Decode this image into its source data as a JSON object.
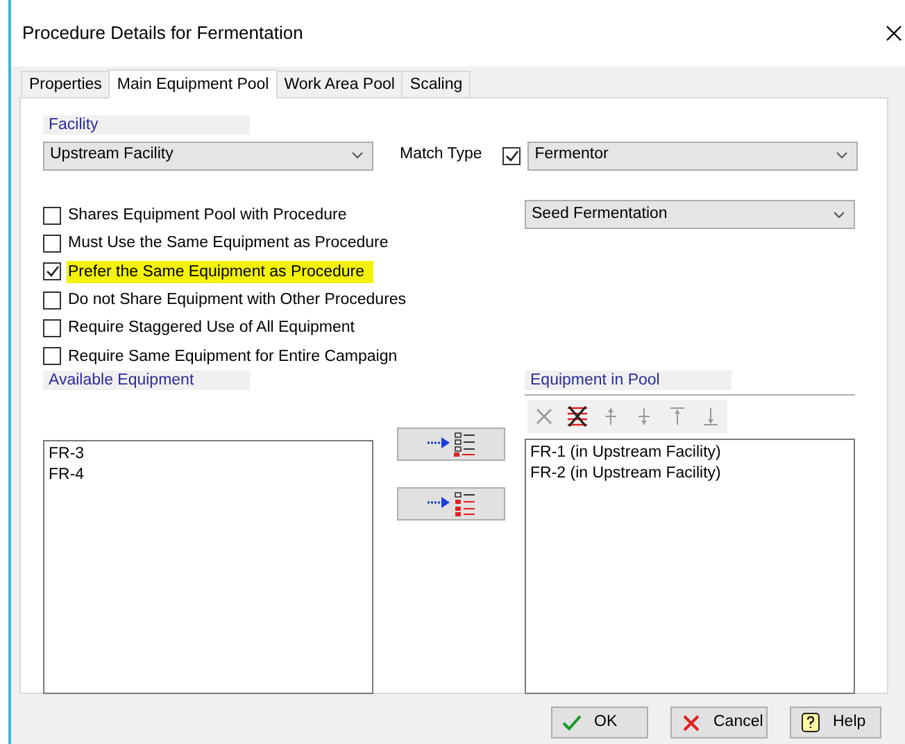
{
  "window": {
    "title": "Procedure Details for Fermentation"
  },
  "tabs": [
    {
      "label": "Properties",
      "selected": false
    },
    {
      "label": "Main Equipment Pool",
      "selected": true
    },
    {
      "label": "Work Area Pool",
      "selected": false
    },
    {
      "label": "Scaling",
      "selected": false
    }
  ],
  "facility": {
    "label": "Facility",
    "value": "Upstream Facility"
  },
  "match_type": {
    "label": "Match Type",
    "checked": true,
    "value": "Fermentor"
  },
  "procedure_select": {
    "value": "Seed Fermentation"
  },
  "options": [
    {
      "label": "Shares Equipment Pool with Procedure",
      "checked": false,
      "highlighted": false
    },
    {
      "label": "Must Use the Same Equipment as Procedure",
      "checked": false,
      "highlighted": false
    },
    {
      "label": "Prefer the Same Equipment as Procedure",
      "checked": true,
      "highlighted": true
    },
    {
      "label": "Do not Share Equipment with Other Procedures",
      "checked": false,
      "highlighted": false
    },
    {
      "label": "Require Staggered Use of All Equipment",
      "checked": false,
      "highlighted": false
    },
    {
      "label": "Require Same Equipment for Entire Campaign",
      "checked": false,
      "highlighted": false
    }
  ],
  "available_equipment": {
    "label": "Available Equipment",
    "items": [
      "FR-3",
      "FR-4"
    ]
  },
  "transfer_buttons": [
    {
      "kind": "add"
    },
    {
      "kind": "add-all"
    }
  ],
  "equipment_in_pool": {
    "label": "Equipment in Pool",
    "items": [
      "FR-1 (in Upstream Facility)",
      "FR-2 (in Upstream Facility)"
    ]
  },
  "pool_toolbar": [
    {
      "kind": "remove",
      "disabled": true
    },
    {
      "kind": "remove-all",
      "disabled": false
    },
    {
      "kind": "up",
      "disabled": true
    },
    {
      "kind": "down",
      "disabled": true
    },
    {
      "kind": "top",
      "disabled": true
    },
    {
      "kind": "bottom",
      "disabled": true
    }
  ],
  "buttons": [
    {
      "kind": "ok",
      "label": "OK"
    },
    {
      "kind": "cancel",
      "label": "Cancel"
    },
    {
      "kind": "help",
      "label": "Help"
    }
  ]
}
